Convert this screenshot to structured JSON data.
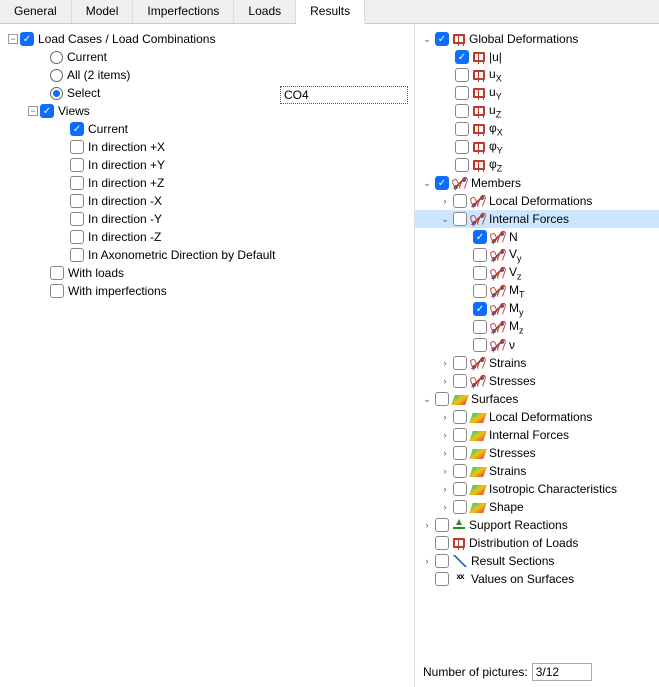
{
  "tabs": {
    "general": "General",
    "model": "Model",
    "imperfections": "Imperfections",
    "loads": "Loads",
    "results": "Results"
  },
  "left": {
    "root": "Load Cases / Load Combinations",
    "current": "Current",
    "all": "All (2 items)",
    "select": "Select",
    "select_value": "CO4",
    "views": "Views",
    "v_current": "Current",
    "v_px": "In direction +X",
    "v_py": "In direction +Y",
    "v_pz": "In direction +Z",
    "v_mx": "In direction -X",
    "v_my": "In direction -Y",
    "v_mz": "In direction -Z",
    "v_axo": "In Axonometric Direction by Default",
    "with_loads": "With loads",
    "with_imperf": "With imperfections"
  },
  "right": {
    "global_def": "Global Deformations",
    "u": "|u|",
    "ux": "u",
    "uy": "u",
    "uz": "u",
    "phix": "φ",
    "phiy": "φ",
    "phiz": "φ",
    "sub_x": "X",
    "sub_y": "Y",
    "sub_z": "Z",
    "members": "Members",
    "local_def": "Local Deformations",
    "internal_forces": "Internal Forces",
    "n": "N",
    "vy": "V",
    "vz": "V",
    "mt": "M",
    "my": "M",
    "mz": "M",
    "nu": "ν",
    "sub_t": "T",
    "sub_ly": "y",
    "sub_lz": "z",
    "strains": "Strains",
    "stresses": "Stresses",
    "surfaces": "Surfaces",
    "s_localdef": "Local Deformations",
    "s_internal": "Internal Forces",
    "s_stresses": "Stresses",
    "s_strains": "Strains",
    "s_iso": "Isotropic Characteristics",
    "s_shape": "Shape",
    "support": "Support Reactions",
    "dist_loads": "Distribution of Loads",
    "result_sections": "Result Sections",
    "values_surf": "Values on Surfaces"
  },
  "footer": {
    "label": "Number of pictures:",
    "value": "3/12"
  }
}
